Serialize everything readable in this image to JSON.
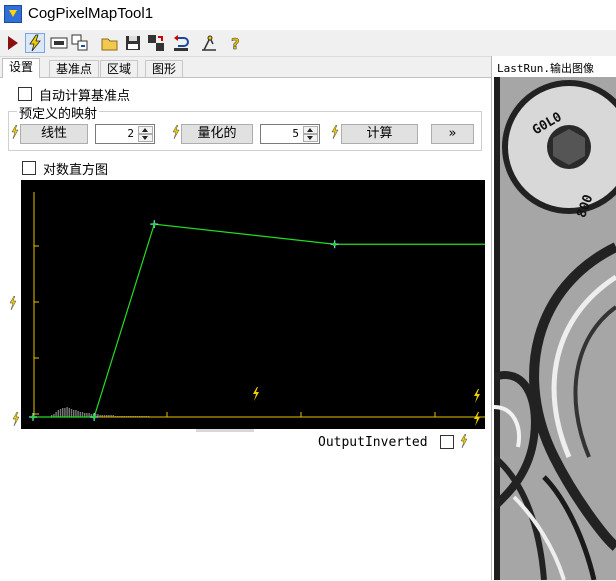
{
  "window": {
    "title": "CogPixelMapTool1"
  },
  "toolbar": {
    "icons": [
      "run-icon",
      "electric-icon",
      "display-icon",
      "reset-icon",
      "open-icon",
      "save-icon",
      "import-export-icon",
      "undo-icon",
      "settings-icon",
      "help-icon"
    ]
  },
  "tabs": [
    {
      "label": "设置",
      "active": true
    },
    {
      "label": "基准点",
      "active": false
    },
    {
      "label": "区域",
      "active": false
    },
    {
      "label": "图形",
      "active": false
    }
  ],
  "settings": {
    "auto_compute_label": "自动计算基准点",
    "auto_compute_checked": false,
    "predefined_group_title": "预定义的映射",
    "linear_button": "线性",
    "linear_value": "2",
    "quantize_button": "量化的",
    "quantize_value": "5",
    "compute_button": "计算",
    "expand_button": "»",
    "log_histogram_label": "对数直方图",
    "log_histogram_checked": false,
    "output_inverted_label": "OutputInverted",
    "output_inverted_checked": false
  },
  "right_pane": {
    "title": "LastRun.输出图像"
  },
  "colors": {
    "accent": "#2f6fd6",
    "curve": "#22dd22",
    "axis": "#e6c200",
    "bolt": "#f0d000"
  },
  "chart_data": {
    "type": "line",
    "x": [
      0,
      64,
      128,
      320,
      480
    ],
    "values": [
      0,
      0,
      240,
      215,
      215
    ],
    "xlim": [
      0,
      480
    ],
    "ylim": [
      0,
      280
    ],
    "grid": false,
    "histogram": [
      2,
      3,
      5,
      7,
      8,
      9,
      9,
      10,
      9,
      8,
      7,
      7,
      6,
      5,
      5,
      4,
      4,
      4,
      3,
      3,
      3,
      3,
      2,
      2,
      2,
      2,
      2,
      2,
      2,
      1,
      1,
      1,
      1,
      1,
      1,
      1,
      1,
      1,
      1,
      1,
      1,
      1,
      1,
      1,
      1
    ]
  }
}
